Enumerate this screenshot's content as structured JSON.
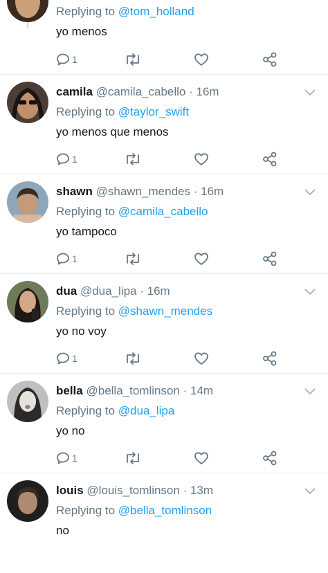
{
  "top_tweet": {
    "replying_prefix": "Replying to",
    "replying_handle": "@tom_holland",
    "text": "yo menos",
    "reply_count": "1"
  },
  "tweets": [
    {
      "name": "camila",
      "handle": "@camila_cabello",
      "time": "· 16m",
      "replying_prefix": "Replying to",
      "replying_handle": "@taylor_swift",
      "text": "yo menos que menos",
      "reply_count": "1"
    },
    {
      "name": "shawn",
      "handle": "@shawn_mendes",
      "time": "· 16m",
      "replying_prefix": "Replying to",
      "replying_handle": "@camila_cabello",
      "text": "yo tampoco",
      "reply_count": "1"
    },
    {
      "name": "dua",
      "handle": "@dua_lipa",
      "time": "· 16m",
      "replying_prefix": "Replying to",
      "replying_handle": "@shawn_mendes",
      "text": "yo no voy",
      "reply_count": "1"
    },
    {
      "name": "bella",
      "handle": "@bella_tomlinson",
      "time": "· 14m",
      "replying_prefix": "Replying to",
      "replying_handle": "@dua_lipa",
      "text": "yo no",
      "reply_count": "1"
    },
    {
      "name": "louis",
      "handle": "@louis_tomlinson",
      "time": "· 13m",
      "replying_prefix": "Replying to",
      "replying_handle": "@bella_tomlinson",
      "text": "no",
      "reply_count": ""
    }
  ],
  "colors": {
    "link": "#1da1f2",
    "muted": "#657786",
    "text": "#14171a"
  }
}
